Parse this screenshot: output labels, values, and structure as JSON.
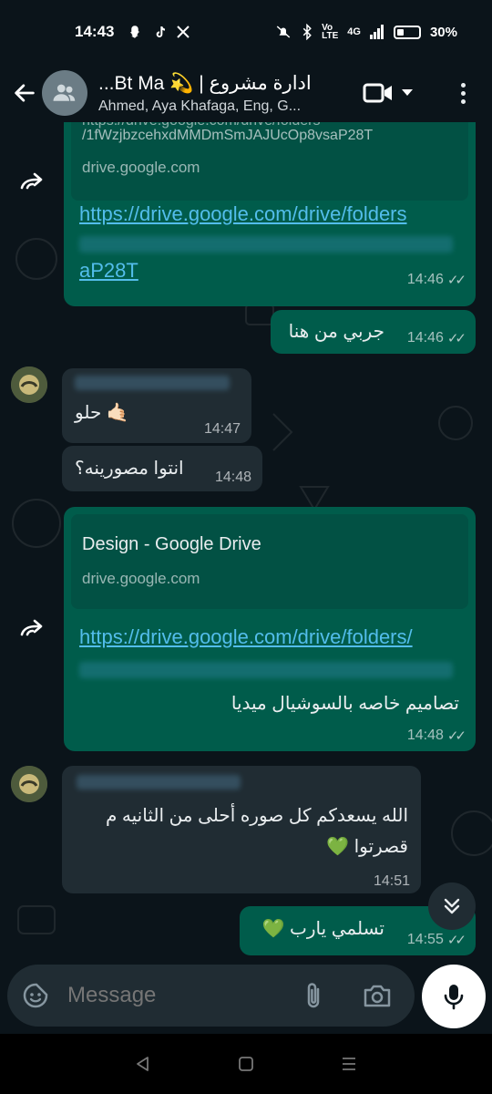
{
  "status_bar": {
    "time": "14:43",
    "battery": "30%",
    "network": "4G"
  },
  "header": {
    "title": "ادارة مشروع | 💫 Bt Ma...",
    "subtitle": "Ahmed, Aya Khafaga, Eng, G..."
  },
  "messages": {
    "m1": {
      "preview_url_line1": "https://drive.google.com/drive/folders",
      "preview_url_line2": "/1fWzjbzcehxdMMDmSmJAJUcOp8vsaP28T",
      "preview_domain": "drive.google.com",
      "link_line1": "https://drive.google.com/drive/folders",
      "link_line3": "aP28T",
      "time": "14:46"
    },
    "m2": {
      "text": "جربي من هنا",
      "time": "14:46"
    },
    "m3": {
      "text": "حلو 🤙🏻",
      "time": "14:47"
    },
    "m4": {
      "text": "انتوا مصورينه؟",
      "time": "14:48"
    },
    "m5": {
      "preview_title": "Design - Google Drive",
      "preview_domain": "drive.google.com",
      "link_line1": "https://drive.google.com/drive/folders/",
      "text": "تصاميم خاصه بالسوشيال ميديا",
      "time": "14:48"
    },
    "m6": {
      "text": "الله يسعدكم كل صوره أحلى من الثانيه م قصرتوا 💚",
      "time": "14:51"
    },
    "m7": {
      "text": "تسلمي يارب 💚",
      "time": "14:55"
    }
  },
  "input": {
    "placeholder": "Message"
  },
  "colors": {
    "background": "#0b141a",
    "outgoing_bubble": "#005c4b",
    "incoming_bubble": "#202c33",
    "link": "#53bdeb"
  }
}
